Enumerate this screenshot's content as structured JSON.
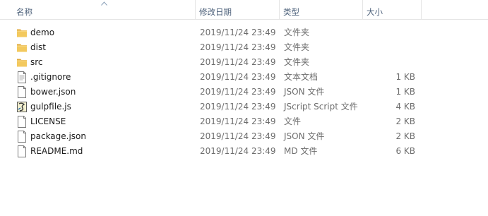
{
  "columns": {
    "name": "名称",
    "date": "修改日期",
    "type": "类型",
    "size": "大小"
  },
  "files": [
    {
      "name": "demo",
      "date": "2019/11/24 23:49",
      "type": "文件夹",
      "size": "",
      "icon": "folder-icon"
    },
    {
      "name": "dist",
      "date": "2019/11/24 23:49",
      "type": "文件夹",
      "size": "",
      "icon": "folder-icon"
    },
    {
      "name": "src",
      "date": "2019/11/24 23:49",
      "type": "文件夹",
      "size": "",
      "icon": "folder-icon"
    },
    {
      "name": ".gitignore",
      "date": "2019/11/24 23:49",
      "type": "文本文档",
      "size": "1 KB",
      "icon": "text-file-icon"
    },
    {
      "name": "bower.json",
      "date": "2019/11/24 23:49",
      "type": "JSON 文件",
      "size": "1 KB",
      "icon": "file-icon"
    },
    {
      "name": "gulpfile.js",
      "date": "2019/11/24 23:49",
      "type": "JScript Script 文件",
      "size": "4 KB",
      "icon": "script-file-icon"
    },
    {
      "name": "LICENSE",
      "date": "2019/11/24 23:49",
      "type": "文件",
      "size": "2 KB",
      "icon": "file-icon"
    },
    {
      "name": "package.json",
      "date": "2019/11/24 23:49",
      "type": "JSON 文件",
      "size": "2 KB",
      "icon": "file-icon"
    },
    {
      "name": "README.md",
      "date": "2019/11/24 23:49",
      "type": "MD 文件",
      "size": "6 KB",
      "icon": "file-icon"
    }
  ],
  "colors": {
    "header_text": "#4c607a",
    "folder": "#e8b64a",
    "muted_text": "#6d6d6d"
  }
}
